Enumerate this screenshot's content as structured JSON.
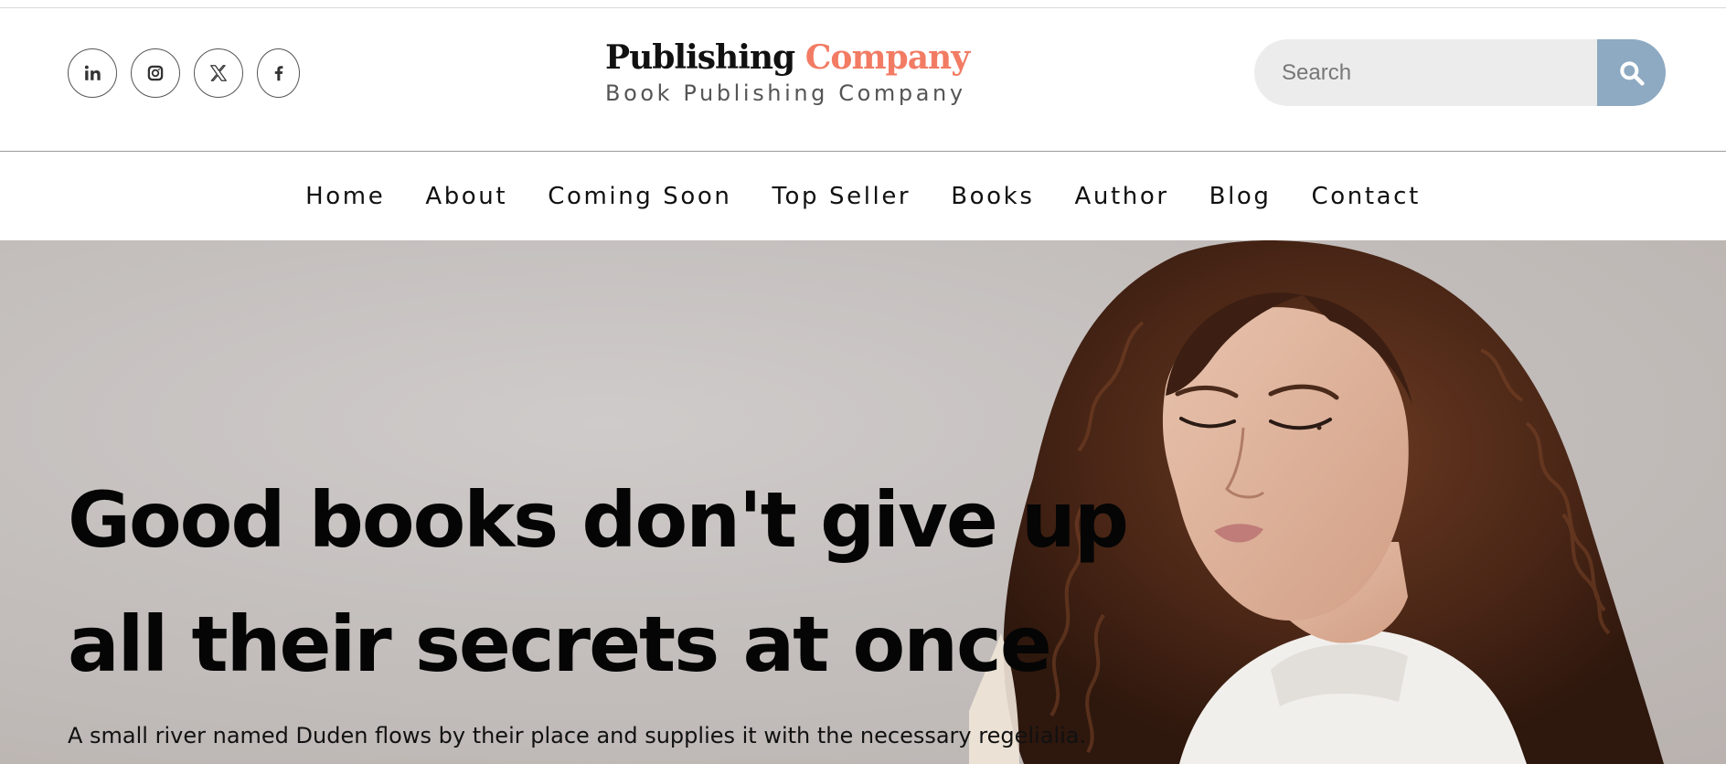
{
  "header": {
    "social": [
      {
        "icon": "linkedin-icon"
      },
      {
        "icon": "instagram-icon"
      },
      {
        "icon": "x-icon"
      },
      {
        "icon": "facebook-icon"
      }
    ],
    "brand": {
      "title_main": "Publishing",
      "title_accent": "Company",
      "subtitle": "Book Publishing Company",
      "accent_color": "#f27b64"
    },
    "search": {
      "placeholder": "Search",
      "button_color": "#8eaac2",
      "icon": "search-icon"
    }
  },
  "nav": {
    "items": [
      "Home",
      "About",
      "Coming Soon",
      "Top Seller",
      "Books",
      "Author",
      "Blog",
      "Contact"
    ]
  },
  "hero": {
    "title_line1": "Good books don't give up",
    "title_line2": "all their secrets at once",
    "text": "A small river named Duden flows by their place and supplies it with the necessary regelialia."
  }
}
